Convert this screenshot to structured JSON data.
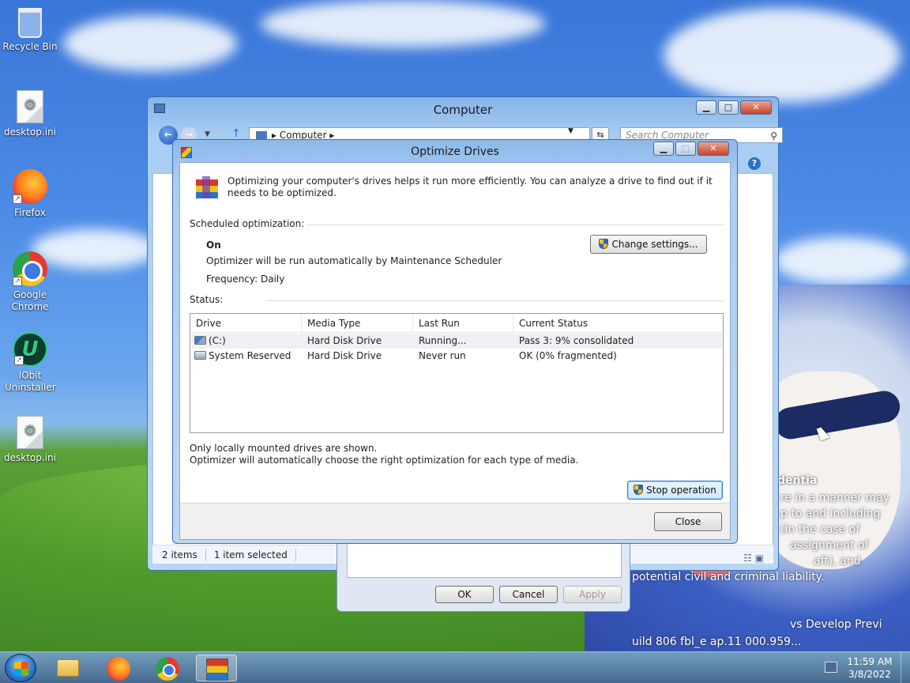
{
  "desktop": {
    "icons": [
      {
        "label": "Recycle Bin",
        "icon": "recycle-bin-icon"
      },
      {
        "label": "desktop.ini",
        "icon": "settings-file-icon"
      },
      {
        "label": "Firefox",
        "icon": "firefox-icon"
      },
      {
        "label": "Google Chrome",
        "icon": "chrome-icon"
      },
      {
        "label": "IObit Uninstaller",
        "icon": "iobit-icon"
      },
      {
        "label": "desktop.ini",
        "icon": "settings-file-icon"
      }
    ],
    "wallpaper_text": [
      "dentia",
      "re in a manner may",
      "p to and including",
      "(in the case of",
      "assignment of",
      "aft), and",
      "potential civil and criminal liability.",
      "vs Develop Previ",
      "uild 806 fbl_e ap.11 000.959..."
    ]
  },
  "explorer": {
    "title": "Computer",
    "address_path": "Computer",
    "search_placeholder": "Search Computer",
    "status_items": "2 items",
    "status_selected": "1 item selected"
  },
  "props_dialog": {
    "ok_label": "OK",
    "cancel_label": "Cancel",
    "apply_label": "Apply"
  },
  "optimize": {
    "title": "Optimize Drives",
    "header_text": "Optimizing your computer's drives helps it run more efficiently. You can analyze a drive to find out if it needs to be optimized.",
    "scheduled_label": "Scheduled optimization:",
    "schedule_state": "On",
    "schedule_desc": "Optimizer will be run automatically by Maintenance Scheduler",
    "frequency": "Frequency: Daily",
    "change_settings_label": "Change settings...",
    "status_label": "Status:",
    "columns": [
      "Drive",
      "Media Type",
      "Last Run",
      "Current Status"
    ],
    "drives": [
      {
        "drive": "(C:)",
        "media": "Hard Disk Drive",
        "last_run": "Running...",
        "status": "Pass 3: 9% consolidated"
      },
      {
        "drive": "System Reserved",
        "media": "Hard Disk Drive",
        "last_run": "Never run",
        "status": "OK (0% fragmented)"
      }
    ],
    "note1": "Only locally mounted drives are shown.",
    "note2": "Optimizer will automatically choose the right optimization for each type of media.",
    "stop_label": "Stop operation",
    "close_label": "Close"
  },
  "taskbar": {
    "time": "11:59 AM",
    "date": "3/8/2022"
  }
}
